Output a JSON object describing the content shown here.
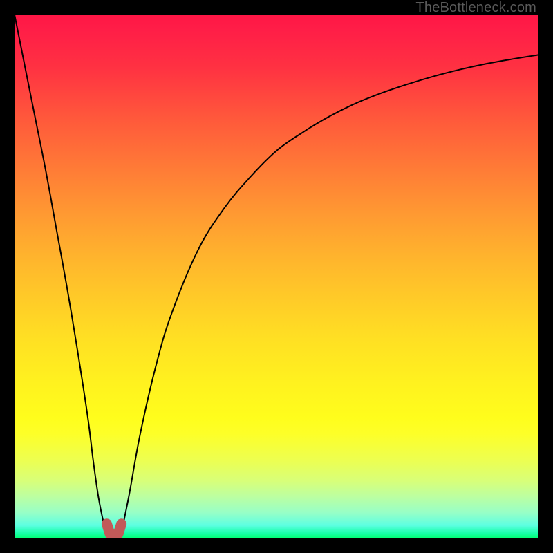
{
  "attribution": "TheBottleneck.com",
  "chart_data": {
    "type": "line",
    "title": "",
    "xlabel": "",
    "ylabel": "",
    "xlim": [
      0,
      100
    ],
    "ylim": [
      0,
      100
    ],
    "grid": false,
    "legend": false,
    "background_gradient": {
      "direction": "vertical",
      "stops": [
        {
          "pos": 0,
          "color": "#ff1646"
        },
        {
          "pos": 50,
          "color": "#ffc028"
        },
        {
          "pos": 80,
          "color": "#fbff22"
        },
        {
          "pos": 100,
          "color": "#00ff71"
        }
      ]
    },
    "series": [
      {
        "name": "left-curve",
        "color": "#000000",
        "x": [
          0,
          2,
          4,
          6,
          8,
          10,
          12,
          14,
          15,
          16,
          17,
          17.8
        ],
        "y": [
          100,
          90,
          80,
          70,
          59,
          48,
          36,
          23,
          15,
          8,
          3,
          0
        ]
      },
      {
        "name": "right-curve",
        "color": "#000000",
        "x": [
          20.2,
          21,
          22,
          24,
          27,
          30,
          35,
          40,
          45,
          50,
          55,
          60,
          65,
          70,
          75,
          80,
          85,
          90,
          95,
          100
        ],
        "y": [
          0,
          4,
          9,
          20,
          33,
          43,
          55,
          63,
          69,
          74,
          77.5,
          80.5,
          83,
          85,
          86.7,
          88.2,
          89.5,
          90.6,
          91.5,
          92.3
        ]
      },
      {
        "name": "dip-marker",
        "color": "#c15a59",
        "type": "marker",
        "x": [
          17.6,
          18.2,
          19,
          19.8,
          20.4
        ],
        "y": [
          2.8,
          0.9,
          0.5,
          0.9,
          2.8
        ]
      }
    ],
    "notes": "Bottleneck-style V curve: y≈0 (green, no bottleneck) at target ratio ~19%, rising sharply toward 100 (red, severe bottleneck) on both sides."
  }
}
